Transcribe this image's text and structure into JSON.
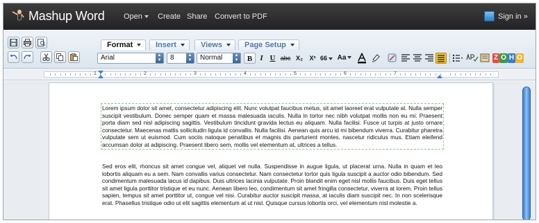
{
  "app": {
    "title": "Mashup Word",
    "menu": [
      "Open",
      "Create",
      "Share",
      "Convert to PDF"
    ],
    "sign_in": "Sign in »"
  },
  "toolbar": {
    "tabs": [
      "Format",
      "Insert",
      "Views",
      "Page Setup"
    ],
    "font_family": "Arial",
    "font_size": "8",
    "style": "Normal",
    "bold": "B",
    "italic": "I",
    "underline": "U",
    "strikethrough": "abc",
    "subscript": "X₂",
    "superscript": "X²",
    "quote": "66",
    "text_case": "Aa"
  },
  "ruler": {
    "numbers": [
      "1",
      "2",
      "3",
      "4",
      "5",
      "6",
      "7"
    ]
  },
  "document": {
    "paragraphs": [
      "Lorem ipsum dolor sit amet, consectetur adipiscing elit. Nunc volutpat faucibus metus, sit amet laoreet erat vulputate at. Nulla semper suscipit vestibulum. Donec semper quam et massa malesuada iaculis. Nulla in tortor nec nibh volutpat mollis non eu mi. Praesent porta diam sed nisl adipiscing sagittis. Vestibulum tincidunt gravida lectus eu aliquam. Nulla facilisi. Fusce ut turpis at justo ornare consectetur. Maecenas mattis sollicitudin ligula id convallis. Nulla facilisi. Aenean quis arcu id mi bibendum viverra. Curabitur pharetra vulputate sem ut euismod. Cum sociis natoque penatibus et magnis dis parturient montes, nascetur ridiculus mus. Etiam eleifend accumsan dolor at adipiscing. Praesent libero sem, mollis vel elementum at, ultrices a tellus.",
      "Sed eros elit, rhoncus sit amet congue vel, aliquet vel nulla. Suspendisse in augue ligula, ut placerat urna. Nulla in quam et leo lobortis aliquam eu a sem. Nam convallis varius consectetur. Nam consectetur tortor quis ligula suscipit a auctor odio bibendum. Sed condimentum malesuada lacus id dapibus. Duis ultrices lacinia vulputate. Proin blandit enim eget nisl mollis faucibus. Duis eget tellus sit amet ligula porttitor tristique et eu nunc. Aenean libero leo, condimentum sit amet fringilla consectetur, viverra at lorem. Proin tellus sapien, tempus sit amet porttitor ut, congue vel nisi. Curabitur auctor suscipit massa, at iaculis diam suscipit nec. In non scelerisque erat. Phasellus tristique odio ut elit sagittis elementum at ut nisl. Quisque cursus lobortis orci, vel elementum nisl molestie a."
    ]
  },
  "icons": [
    "logo-icon",
    "save-icon",
    "print-icon",
    "preview-icon",
    "undo-icon",
    "redo-icon",
    "cut-icon",
    "copy-icon",
    "paste-icon",
    "font-color-icon",
    "highlight-icon",
    "clear-format-icon",
    "align-left-icon",
    "align-center-icon",
    "align-right-icon",
    "align-justify-icon",
    "list-icon",
    "spellcheck-icon",
    "dictionary-icon",
    "zoho-icon",
    "user-icon"
  ],
  "colors": {
    "accent": "#3c7fd0",
    "topbar": "#2e2e2e",
    "tab_text": "#4f79a8"
  }
}
